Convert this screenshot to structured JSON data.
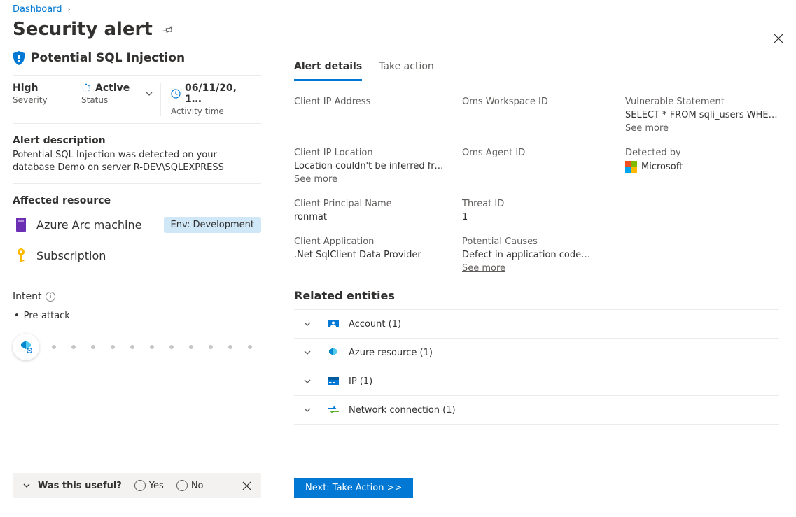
{
  "breadcrumb": {
    "root": "Dashboard"
  },
  "page_title": "Security alert",
  "alert": {
    "title": "Potential SQL Injection",
    "severity_value": "High",
    "severity_label": "Severity",
    "status_value": "Active",
    "status_label": "Status",
    "activity_value": "06/11/20, 1…",
    "activity_label": "Activity time",
    "description_heading": "Alert description",
    "description_text": "Potential SQL Injection was detected on your database Demo on server R-DEV\\SQLEXPRESS",
    "affected_heading": "Affected resource",
    "resources": [
      {
        "icon": "arc-machine",
        "label": "Azure Arc machine",
        "env": "Env: Development"
      },
      {
        "icon": "key",
        "label": "Subscription",
        "env": ""
      }
    ],
    "intent_heading": "Intent",
    "intent_item": "Pre-attack"
  },
  "usefulness": {
    "prompt": "Was this useful?",
    "yes": "Yes",
    "no": "No"
  },
  "tabs": {
    "details": "Alert details",
    "action": "Take action"
  },
  "details": {
    "client_ip_label": "Client IP Address",
    "client_ip_value": "",
    "oms_ws_label": "Oms Workspace ID",
    "oms_ws_value": "",
    "vuln_label": "Vulnerable Statement",
    "vuln_value": "SELECT * FROM sqli_users WHERE…",
    "see_more": "See more",
    "client_loc_label": "Client IP Location",
    "client_loc_value": "Location couldn't be inferred from…",
    "oms_agent_label": "Oms Agent ID",
    "oms_agent_value": "",
    "detected_label": "Detected by",
    "detected_value": "Microsoft",
    "principal_label": "Client Principal Name",
    "principal_value": "ronmat",
    "threat_label": "Threat ID",
    "threat_value": "1",
    "app_label": "Client Application",
    "app_value": ".Net SqlClient Data Provider",
    "causes_label": "Potential Causes",
    "causes_value": "Defect in application code…"
  },
  "related": {
    "heading": "Related entities",
    "items": [
      {
        "label": "Account (1)",
        "icon": "account"
      },
      {
        "label": "Azure resource (1)",
        "icon": "azure"
      },
      {
        "label": "IP (1)",
        "icon": "ip"
      },
      {
        "label": "Network connection (1)",
        "icon": "network"
      }
    ]
  },
  "footer_button": "Next: Take Action  >>"
}
